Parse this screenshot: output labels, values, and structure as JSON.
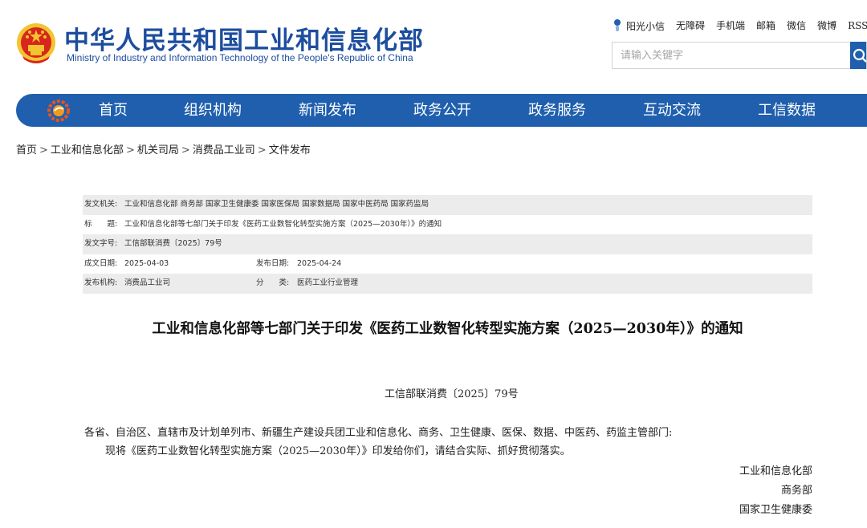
{
  "header": {
    "title_cn": "中华人民共和国工业和信息化部",
    "title_en": "Ministry of Industry and Information Technology of the People's Republic of China",
    "emblem_icon": "national-emblem-icon"
  },
  "toplinks": [
    "阳光小信",
    "无障碍",
    "手机端",
    "邮箱",
    "微信",
    "微博",
    "RSS订"
  ],
  "search": {
    "placeholder": "请输入关键字",
    "icon": "search-icon"
  },
  "nav": {
    "logo_icon": "miit-logo-icon",
    "items": [
      "首页",
      "组织机构",
      "新闻发布",
      "政务公开",
      "政务服务",
      "互动交流",
      "工信数据"
    ]
  },
  "breadcrumb": [
    "首页",
    "工业和信息化部",
    "机关司局",
    "消费品工业司",
    "文件发布"
  ],
  "info": {
    "issuer_label": "发文机关:",
    "issuer": "工业和信息化部 商务部 国家卫生健康委 国家医保局 国家数据局 国家中医药局 国家药监局",
    "title_label": "标　　题:",
    "title": "工业和信息化部等七部门关于印发《医药工业数智化转型实施方案（2025—2030年）》的通知",
    "docno_label": "发文字号:",
    "docno": "工信部联消费〔2025〕79号",
    "written_label": "成文日期:",
    "written": "2025-04-03",
    "published_label": "发布日期:",
    "published": "2025-04-24",
    "agency_label": "发布机构:",
    "agency": "消费品工业司",
    "category_label": "分　　类:",
    "category": "医药工业行业管理"
  },
  "document": {
    "title": "工业和信息化部等七部门关于印发《医药工业数智化转型实施方案（2025—2030年）》的通知",
    "doc_no": "工信部联消费〔2025〕79号",
    "para1": "各省、自治区、直辖市及计划单列市、新疆生产建设兵团工业和信息化、商务、卫生健康、医保、数据、中医药、药监主管部门:",
    "para2": "现将《医药工业数智化转型实施方案（2025—2030年）》印发给你们，请结合实际、抓好贯彻落实。",
    "signatures": [
      "工业和信息化部",
      "商务部",
      "国家卫生健康委"
    ]
  },
  "colors": {
    "brand_blue": "#1f5fae",
    "title_blue": "#1d4d9e",
    "emblem_red": "#d7261c",
    "emblem_gold": "#f4c430"
  }
}
